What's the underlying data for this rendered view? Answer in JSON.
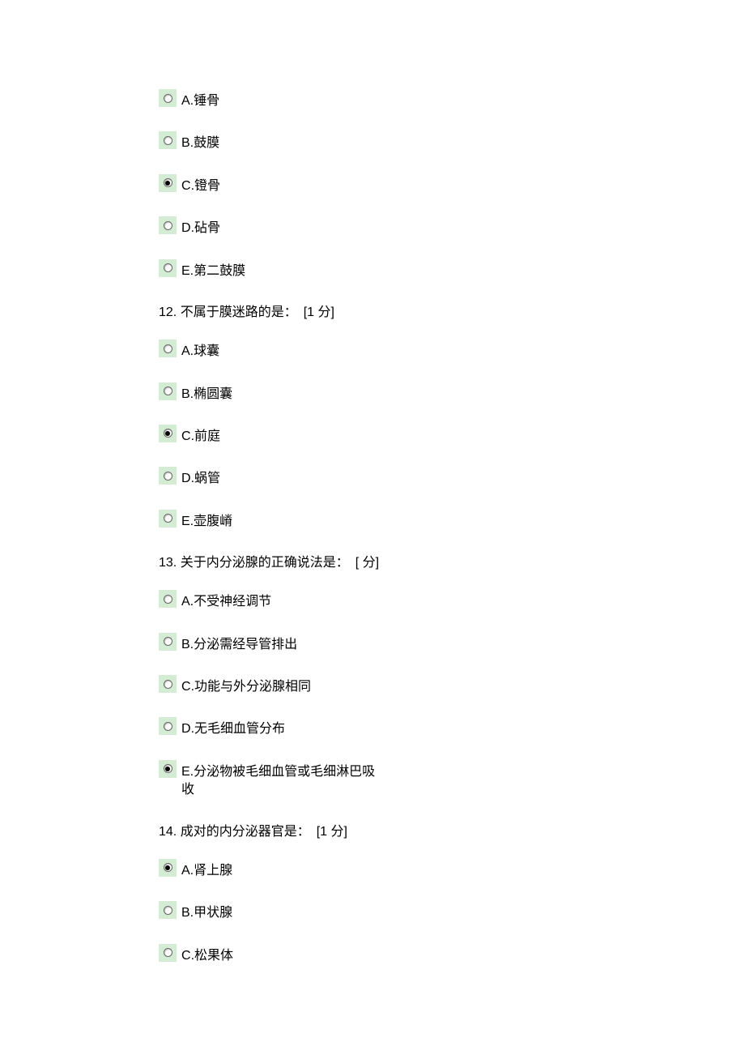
{
  "questions": [
    {
      "number": "",
      "stem": "",
      "points": "",
      "options": [
        {
          "letter": "A",
          "text": "锤骨",
          "selected": false
        },
        {
          "letter": "B",
          "text": "鼓膜",
          "selected": false
        },
        {
          "letter": "C",
          "text": "镫骨",
          "selected": true
        },
        {
          "letter": "D",
          "text": "砧骨",
          "selected": false
        },
        {
          "letter": "E",
          "text": "第二鼓膜",
          "selected": false
        }
      ]
    },
    {
      "number": "12.",
      "stem": "不属于膜迷路的是：",
      "points": "[1 分]",
      "options": [
        {
          "letter": "A",
          "text": "球囊",
          "selected": false
        },
        {
          "letter": "B",
          "text": "椭圆囊",
          "selected": false
        },
        {
          "letter": "C",
          "text": "前庭",
          "selected": true
        },
        {
          "letter": "D",
          "text": "蜗管",
          "selected": false
        },
        {
          "letter": "E",
          "text": "壶腹嵴",
          "selected": false
        }
      ]
    },
    {
      "number": "13.",
      "stem": "关于内分泌腺的正确说法是：",
      "points": "[ 分]",
      "options": [
        {
          "letter": "A",
          "text": "不受神经调节",
          "selected": false
        },
        {
          "letter": "B",
          "text": "分泌需经导管排出",
          "selected": false
        },
        {
          "letter": "C",
          "text": "功能与外分泌腺相同",
          "selected": false
        },
        {
          "letter": "D",
          "text": "无毛细血管分布",
          "selected": false
        },
        {
          "letter": "E",
          "text": "分泌物被毛细血管或毛细淋巴吸收",
          "selected": true
        }
      ]
    },
    {
      "number": "14.",
      "stem": "成对的内分泌器官是：",
      "points": "[1 分]",
      "options": [
        {
          "letter": "A",
          "text": "肾上腺",
          "selected": true
        },
        {
          "letter": "B",
          "text": "甲状腺",
          "selected": false
        },
        {
          "letter": "C",
          "text": "松果体",
          "selected": false
        }
      ]
    }
  ]
}
